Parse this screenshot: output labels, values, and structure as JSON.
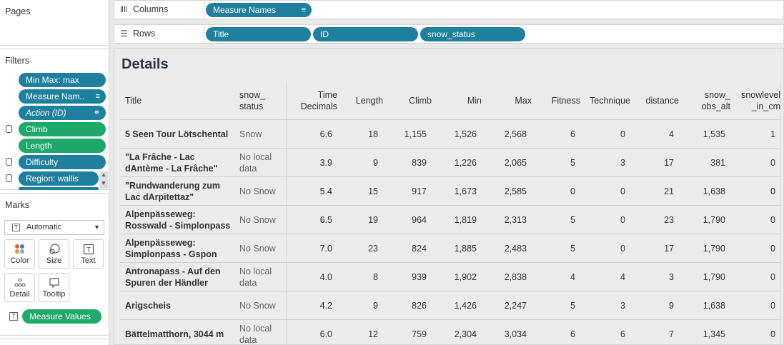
{
  "pages": {
    "title": "Pages"
  },
  "filters": {
    "title": "Filters",
    "items": [
      {
        "label": "Min Max: max",
        "color": "blue",
        "icon": ""
      },
      {
        "label": "Measure Nam..",
        "color": "blue",
        "icon": "sort-icon"
      },
      {
        "label": "Action (ID)",
        "color": "blue",
        "icon": "link-icon"
      },
      {
        "label": "Climb",
        "color": "green",
        "icon": ""
      },
      {
        "label": "Length",
        "color": "green",
        "icon": ""
      },
      {
        "label": "Difficulty",
        "color": "blue",
        "icon": ""
      },
      {
        "label": "Region: wallis",
        "color": "blue",
        "icon": ""
      }
    ]
  },
  "marks": {
    "title": "Marks",
    "type": "Automatic",
    "buttons": [
      "Color",
      "Size",
      "Text",
      "Detail",
      "Tooltip"
    ],
    "measure_pill": "Measure Values"
  },
  "columns_shelf": {
    "label": "Columns",
    "pills": [
      "Measure Names"
    ]
  },
  "rows_shelf": {
    "label": "Rows",
    "pills": [
      "Title",
      "ID",
      "snow_status"
    ]
  },
  "view": {
    "title": "Details",
    "headers": [
      "Title",
      "snow_\nstatus",
      "Time\nDecimals",
      "Length",
      "Climb",
      "Min",
      "Max",
      "Fitness",
      "Technique",
      "distance",
      "snow_\nobs_alt",
      "snowlevel\n_in_cm"
    ],
    "rows": [
      {
        "title": "5 Seen Tour Lötschental",
        "status": "Snow",
        "values": [
          "6.6",
          "18",
          "1,155",
          "1,526",
          "2,568",
          "6",
          "0",
          "4",
          "1,535",
          "1"
        ]
      },
      {
        "title": "\"La Frâche - Lac dAntème - La Frâche\"",
        "status": "No local data",
        "values": [
          "3.9",
          "9",
          "839",
          "1,226",
          "2,065",
          "5",
          "3",
          "17",
          "381",
          "0"
        ]
      },
      {
        "title": "\"Rundwanderung zum Lac dArpitettaz\"",
        "status": "No Snow",
        "values": [
          "5.4",
          "15",
          "917",
          "1,673",
          "2,585",
          "0",
          "0",
          "21",
          "1,638",
          "0"
        ]
      },
      {
        "title": "Alpenpässeweg: Rosswald - Simplonpass",
        "status": "No Snow",
        "values": [
          "6.5",
          "19",
          "964",
          "1,819",
          "2,313",
          "5",
          "0",
          "23",
          "1,790",
          "0"
        ]
      },
      {
        "title": "Alpenpässeweg: Simplonpass - Gspon",
        "status": "No Snow",
        "values": [
          "7.0",
          "23",
          "824",
          "1,885",
          "2,483",
          "5",
          "0",
          "17",
          "1,790",
          "0"
        ]
      },
      {
        "title": "Antronapass - Auf den Spuren der Händler",
        "status": "No local data",
        "values": [
          "4.0",
          "8",
          "939",
          "1,902",
          "2,838",
          "4",
          "4",
          "3",
          "1,790",
          "0"
        ]
      },
      {
        "title": "Arigscheis",
        "status": "No Snow",
        "values": [
          "4.2",
          "9",
          "826",
          "1,426",
          "2,247",
          "5",
          "3",
          "9",
          "1,638",
          "0"
        ]
      },
      {
        "title": "Bättelmatthorn, 3044 m",
        "status": "No local data",
        "values": [
          "6.0",
          "12",
          "759",
          "2,304",
          "3,034",
          "6",
          "6",
          "7",
          "1,345",
          "0"
        ]
      }
    ]
  }
}
